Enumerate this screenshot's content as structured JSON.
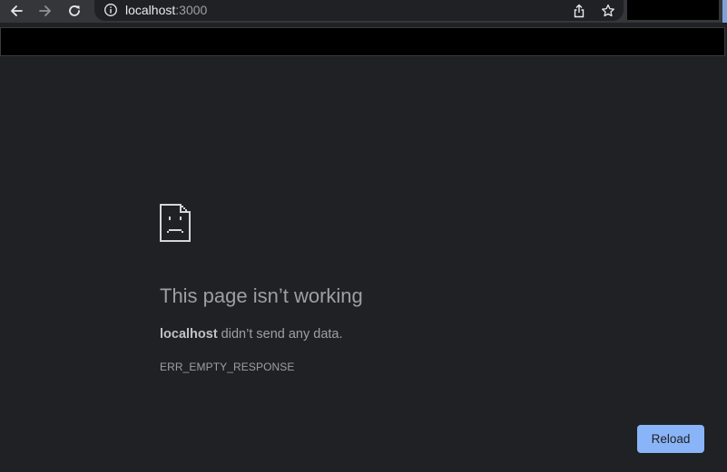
{
  "browser": {
    "url_host": "localhost",
    "url_port": ":3000",
    "icons": {
      "back": "arrow-left-icon",
      "forward": "arrow-right-icon",
      "reload": "reload-icon",
      "site_info": "info-icon",
      "share": "share-icon",
      "bookmark": "star-icon"
    }
  },
  "error": {
    "icon": "sad-page-icon",
    "title": "This page isn’t working",
    "host": "localhost",
    "message_rest": " didn’t send any data.",
    "code": "ERR_EMPTY_RESPONSE",
    "reload_label": "Reload"
  },
  "colors": {
    "background": "#202124",
    "toolbar": "#35363a",
    "text_secondary": "#9aa0a6",
    "button_blue": "#8ab4f8"
  }
}
